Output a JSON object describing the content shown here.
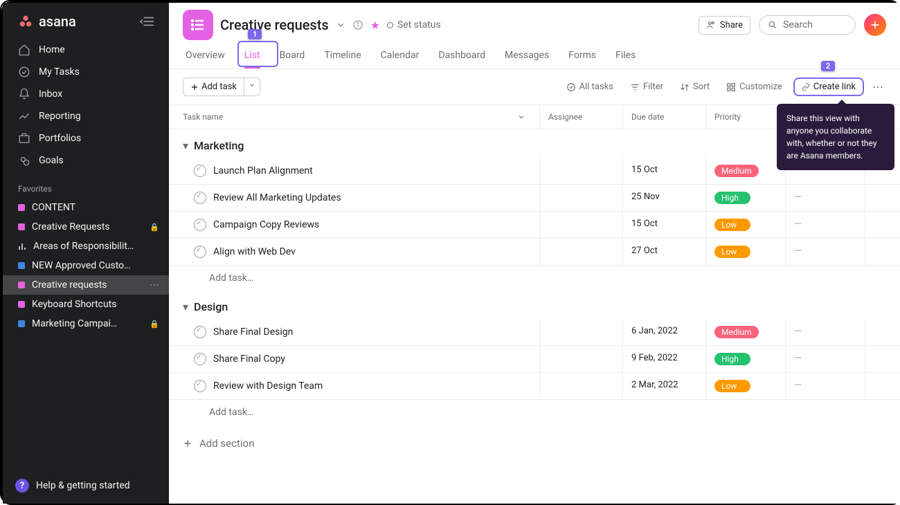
{
  "brand": "asana",
  "sidebar": {
    "nav": [
      {
        "label": "Home"
      },
      {
        "label": "My Tasks"
      },
      {
        "label": "Inbox"
      },
      {
        "label": "Reporting"
      },
      {
        "label": "Portfolios"
      },
      {
        "label": "Goals"
      }
    ],
    "favorites_label": "Favorites",
    "favorites": [
      {
        "label": "CONTENT",
        "color": "#e362e3",
        "kind": "square"
      },
      {
        "label": "Creative Requests",
        "color": "#e362e3",
        "kind": "square",
        "locked": true
      },
      {
        "label": "Areas of Responsibilit…",
        "kind": "bar"
      },
      {
        "label": "NEW Approved Custo…",
        "color": "#4186e0",
        "kind": "square"
      },
      {
        "label": "Creative requests",
        "color": "#e362e3",
        "kind": "square",
        "active": true,
        "dots": true
      },
      {
        "label": "Keyboard Shortcuts",
        "color": "#e362e3",
        "kind": "square"
      },
      {
        "label": "Marketing Campai…",
        "color": "#4186e0",
        "kind": "square",
        "locked": true
      }
    ],
    "help": "Help & getting started",
    "help_qmark": "?"
  },
  "header": {
    "title": "Creative requests",
    "status_label": "Set status",
    "share": "Share",
    "search_placeholder": "Search"
  },
  "tabs": [
    "Overview",
    "List",
    "Board",
    "Timeline",
    "Calendar",
    "Dashboard",
    "Messages",
    "Forms",
    "Files"
  ],
  "active_tab": "List",
  "annotations": {
    "one": "1",
    "two": "2"
  },
  "toolbar": {
    "add_task": "Add task",
    "all_tasks": "All tasks",
    "filter": "Filter",
    "sort": "Sort",
    "customize": "Customize",
    "create_link": "Create link"
  },
  "tooltip": "Share this view with anyone you collaborate with, whether or not they are Asana members.",
  "columns": {
    "task": "Task name",
    "assignee": "Assignee",
    "due": "Due date",
    "priority": "Priority",
    "extra": "",
    "plus": "+"
  },
  "sections": [
    {
      "name": "Marketing",
      "tasks": [
        {
          "name": "Launch Plan Alignment",
          "due": "15 Oct",
          "priority": "Medium"
        },
        {
          "name": "Review All Marketing Updates",
          "due": "25 Nov",
          "priority": "High"
        },
        {
          "name": "Campaign Copy Reviews",
          "due": "15 Oct",
          "priority": "Low"
        },
        {
          "name": "Align with Web Dev",
          "due": "27 Oct",
          "priority": "Low"
        }
      ]
    },
    {
      "name": "Design",
      "tasks": [
        {
          "name": "Share Final Design",
          "due": "6 Jan, 2022",
          "priority": "Medium"
        },
        {
          "name": "Share Final Copy",
          "due": "9 Feb, 2022",
          "priority": "High"
        },
        {
          "name": "Review with Design Team",
          "due": "2 Mar, 2022",
          "priority": "Low"
        }
      ]
    }
  ],
  "add_task_placeholder": "Add task…",
  "add_section": "Add section",
  "dash": "—"
}
